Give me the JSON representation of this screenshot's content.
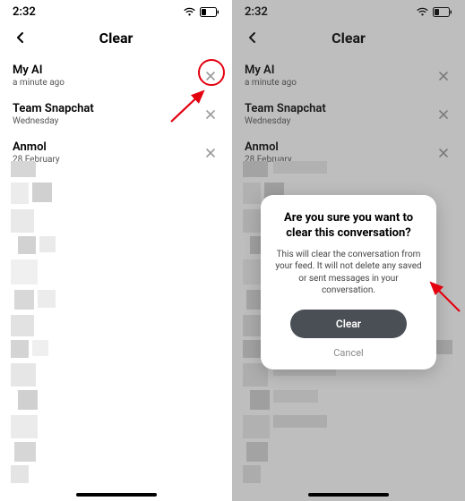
{
  "status": {
    "time": "2:32"
  },
  "header": {
    "title": "Clear"
  },
  "rows": [
    {
      "name": "My AI",
      "sub": "a minute ago"
    },
    {
      "name": "Team Snapchat",
      "sub": "Wednesday"
    },
    {
      "name": "Anmol",
      "sub": "28 February"
    }
  ],
  "dialog": {
    "title": "Are you sure you want to clear this conversation?",
    "body": "This will clear the conversation from your feed. It will not delete any saved or sent messages in your conversation.",
    "confirm": "Clear",
    "cancel": "Cancel"
  }
}
